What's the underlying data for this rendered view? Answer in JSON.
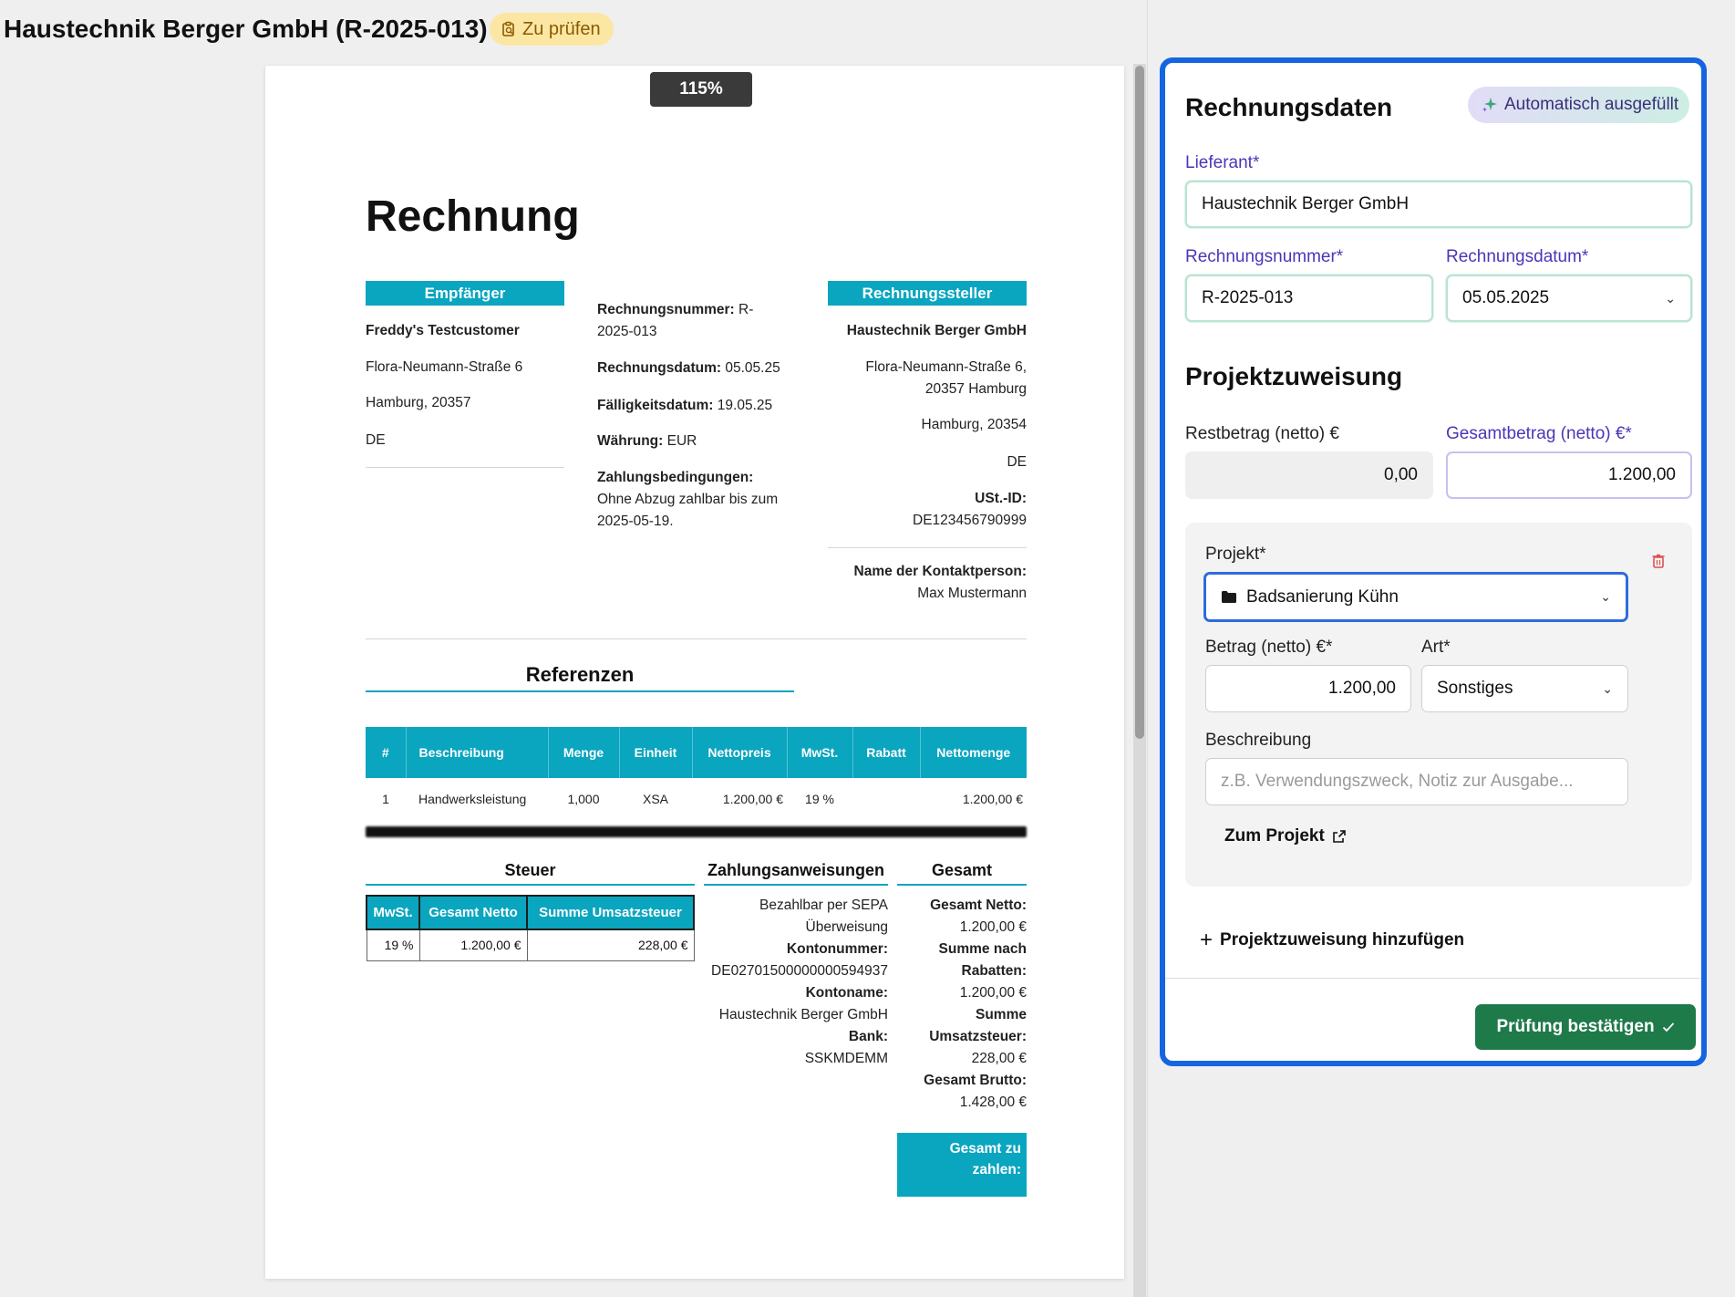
{
  "header": {
    "title": "Haustechnik Berger GmbH (R-2025-013)",
    "status": "Zu prüfen"
  },
  "viewer": {
    "zoom": "115%",
    "document": {
      "title": "Rechnung",
      "recipient": {
        "heading": "Empfänger",
        "name": "Freddy's Testcustomer",
        "street": "Flora-Neumann-Straße 6",
        "city": "Hamburg, 20357",
        "country": "DE"
      },
      "meta": {
        "invoice_no_label": "Rechnungsnummer:",
        "invoice_no_value_1": "R-",
        "invoice_no_value_2": "2025-013",
        "invoice_date_label": "Rechnungsdatum:",
        "invoice_date_value": "05.05.25",
        "due_label": "Fälligkeitsdatum:",
        "due_value": "19.05.25",
        "currency_label": "Währung:",
        "currency_value": "EUR",
        "terms_label": "Zahlungsbedingungen:",
        "terms_1": "Ohne Abzug zahlbar bis zum",
        "terms_2": "2025-05-19."
      },
      "issuer": {
        "heading": "Rechnungssteller",
        "name": "Haustechnik Berger GmbH",
        "street_1": "Flora-Neumann-Straße 6,",
        "street_2": "20357 Hamburg",
        "city": "Hamburg, 20354",
        "country": "DE",
        "vat_label": "USt.-ID:",
        "vat_value": "DE123456790999",
        "contact_label": "Name der Kontaktperson:",
        "contact_value": "Max Mustermann"
      },
      "references_heading": "Referenzen",
      "items": {
        "headers": [
          "#",
          "Beschreibung",
          "Menge",
          "Einheit",
          "Nettopreis",
          "MwSt.",
          "Rabatt",
          "Nettomenge"
        ],
        "rows": [
          [
            "1",
            "Handwerksleistung",
            "1,000",
            "XSA",
            "1.200,00 €",
            "19 %",
            "",
            "1.200,00 €"
          ]
        ]
      },
      "tax": {
        "heading": "Steuer",
        "headers": [
          "MwSt.",
          "Gesamt Netto",
          "Summe Umsatzsteuer"
        ],
        "row": [
          "19 %",
          "1.200,00 €",
          "228,00 €"
        ]
      },
      "payment": {
        "heading": "Zahlungsanweisungen",
        "line_1": "Bezahlbar per SEPA",
        "line_2": "Überweisung",
        "account_no_label": "Kontonummer:",
        "account_no_value": "DE02701500000000594937",
        "account_name_label": "Kontoname:",
        "account_name_value": "Haustechnik Berger GmbH",
        "bank_label": "Bank:",
        "bank_value": "SSKMDEMM"
      },
      "totals": {
        "heading": "Gesamt",
        "net_label": "Gesamt Netto:",
        "net_value": "1.200,00 €",
        "after_discount_label_1": "Summe nach",
        "after_discount_label_2": "Rabatten:",
        "after_discount_value": "1.200,00 €",
        "vat_label_1": "Summe",
        "vat_label_2": "Umsatzsteuer:",
        "vat_value": "228,00 €",
        "gross_label": "Gesamt Brutto:",
        "gross_value": "1.428,00 €",
        "payable_1": "Gesamt zu",
        "payable_2": "zahlen:"
      }
    }
  },
  "panel": {
    "title": "Rechnungsdaten",
    "auto_badge": "Automatisch ausgefüllt",
    "supplier_label": "Lieferant*",
    "supplier_value": "Haustechnik Berger GmbH",
    "invoice_no_label": "Rechnungsnummer*",
    "invoice_no_value": "R-2025-013",
    "invoice_date_label": "Rechnungsdatum*",
    "invoice_date_value": "05.05.2025",
    "assignment_title": "Projektzuweisung",
    "rest_label": "Restbetrag (netto) €",
    "rest_value": "0,00",
    "total_label": "Gesamtbetrag (netto) €*",
    "total_value": "1.200,00",
    "project_label": "Projekt*",
    "project_value": "Badsanierung Kühn",
    "amount_label": "Betrag (netto) €*",
    "amount_value": "1.200,00",
    "type_label": "Art*",
    "type_value": "Sonstiges",
    "description_label": "Beschreibung",
    "description_placeholder": "z.B. Verwendungszweck, Notiz zur Ausgabe...",
    "to_project": "Zum Projekt",
    "add_assignment": "Projektzuweisung hinzufügen",
    "confirm": "Prüfung bestätigen"
  },
  "colors": {
    "accent": "#1565e0",
    "teal": "#0aa5bf",
    "confirm": "#1f7a4a",
    "badge": "#fbe7a3"
  }
}
